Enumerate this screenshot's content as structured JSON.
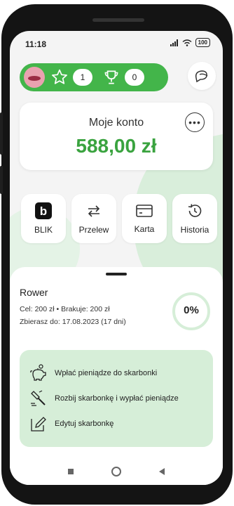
{
  "status_bar": {
    "time": "11:18",
    "battery": "100"
  },
  "rewards": {
    "stars": "1",
    "trophies": "0"
  },
  "account": {
    "name": "Moje konto",
    "balance": "588,00 zł"
  },
  "actions": [
    {
      "label": "BLIK",
      "icon": "blik-icon"
    },
    {
      "label": "Przelew",
      "icon": "transfer-icon"
    },
    {
      "label": "Karta",
      "icon": "card-icon"
    },
    {
      "label": "Historia",
      "icon": "history-icon"
    }
  ],
  "goal": {
    "title": "Rower",
    "details": "Cel: 200 zł • Brakuje: 200 zł",
    "deadline": "Zbierasz do: 17.08.2023 (17 dni)",
    "progress_label": "0%",
    "progress_fraction": 0
  },
  "menu": [
    {
      "label": "Wpłać pieniądze do skarbonki",
      "icon": "piggy-bank-icon"
    },
    {
      "label": "Rozbij skarbonkę i wypłać pieniądze",
      "icon": "hammer-icon"
    },
    {
      "label": "Edytuj skarbonkę",
      "icon": "edit-icon"
    }
  ],
  "colors": {
    "accent": "#43b54a",
    "balance": "#3aa33f",
    "panel": "#d6eed8"
  }
}
